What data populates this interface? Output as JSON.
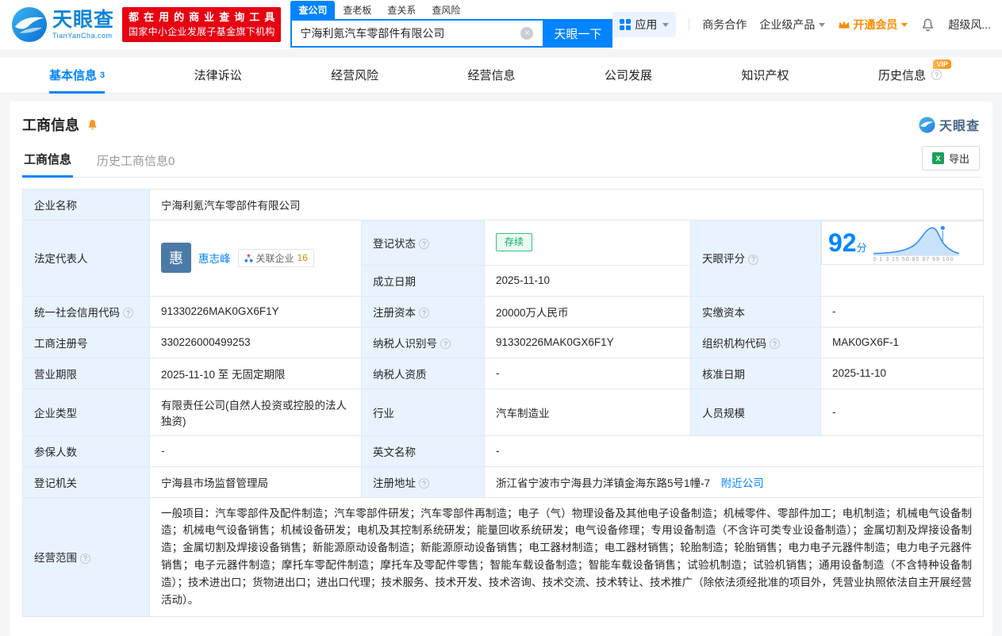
{
  "topbar": {
    "brand": "天眼查",
    "brand_domain": "TianYanCha.com",
    "slogan_line1": "都在用的商业查询工具",
    "slogan_line2": "国家中小企业发展子基金旗下机构",
    "search_tabs": {
      "company": "查公司",
      "boss": "查老板",
      "relation": "查关系",
      "risk": "查风险"
    },
    "search_value": "宁海利氪汽车零部件有限公司",
    "search_button": "天眼一下",
    "apps": "应用",
    "biz_coop": "商务合作",
    "enterprise_product": "企业级产品",
    "open_vip": "开通会员",
    "super_risk": "超级风..."
  },
  "nav": {
    "basic": "基本信息",
    "basic_count": "3",
    "legal": "法律诉讼",
    "risk": "经营风险",
    "operation": "经营信息",
    "development": "公司发展",
    "ip": "知识产权",
    "history": "历史信息",
    "vip_tag": "VIP"
  },
  "section": {
    "title": "工商信息",
    "brand_mini": "天眼查",
    "tab_current": "工商信息",
    "tab_history": "历史工商信息0",
    "export": "导出"
  },
  "biz": {
    "company_name_label": "企业名称",
    "company_name": "宁海利氪汽车零部件有限公司",
    "legal_rep_label": "法定代表人",
    "legal_rep_avatar": "惠",
    "legal_rep_name": "惠志峰",
    "related_companies_label": "关联企业",
    "related_companies_count": "16",
    "reg_status_label": "登记状态",
    "reg_status": "存续",
    "establish_date_label": "成立日期",
    "establish_date": "2025-11-10",
    "score_label": "天眼评分",
    "score_value": "92",
    "score_unit": "分",
    "score_ticks": [
      "0",
      "1",
      "3",
      "15",
      "50",
      "85",
      "97",
      "99",
      "100"
    ],
    "credit_code_label": "统一社会信用代码",
    "credit_code": "91330226MAK0GX6F1Y",
    "reg_capital_label": "注册资本",
    "reg_capital": "20000万人民币",
    "paid_capital_label": "实缴资本",
    "paid_capital": "-",
    "reg_number_label": "工商注册号",
    "reg_number": "330226000499253",
    "taxpayer_id_label": "纳税人识别号",
    "taxpayer_id": "91330226MAK0GX6F1Y",
    "org_code_label": "组织机构代码",
    "org_code": "MAK0GX6F-1",
    "business_term_label": "营业期限",
    "business_term": "2025-11-10 至 无固定期限",
    "taxpayer_quality_label": "纳税人资质",
    "taxpayer_quality": "-",
    "approval_date_label": "核准日期",
    "approval_date": "2025-11-10",
    "company_type_label": "企业类型",
    "company_type": "有限责任公司(自然人投资或控股的法人独资)",
    "industry_label": "行业",
    "industry": "汽车制造业",
    "staff_size_label": "人员规模",
    "staff_size": "-",
    "insured_label": "参保人数",
    "insured": "-",
    "english_name_label": "英文名称",
    "english_name": "-",
    "reg_authority_label": "登记机关",
    "reg_authority": "宁海县市场监督管理局",
    "reg_address_label": "注册地址",
    "reg_address": "浙江省宁波市宁海县力洋镇金海东路5号1幢-7",
    "nearby_link": "附近公司",
    "business_scope_label": "经营范围",
    "business_scope": "一般项目：汽车零部件及配件制造；汽车零部件研发；汽车零部件再制造；电子（气）物理设备及其他电子设备制造；机械零件、零部件加工；电机制造；机械电气设备制造；机械电气设备销售；机械设备研发；电机及其控制系统研发；能量回收系统研发；电气设备修理；专用设备制造（不含许可类专业设备制造）；金属切割及焊接设备制造；金属切割及焊接设备销售；新能源原动设备制造；新能源原动设备销售；电工器材制造；电工器材销售；轮胎制造；轮胎销售；电力电子元器件制造；电力电子元器件销售；电子元器件制造；摩托车零配件制造；摩托车及零配件零售；智能车载设备制造；智能车载设备销售；试验机制造；试验机销售；通用设备制造（不含特种设备制造）；技术进出口；货物进出口；进出口代理；技术服务、技术开发、技术咨询、技术交流、技术转让、技术推广（除依法须经批准的项目外，凭营业执照依法自主开展经营活动）。"
  }
}
